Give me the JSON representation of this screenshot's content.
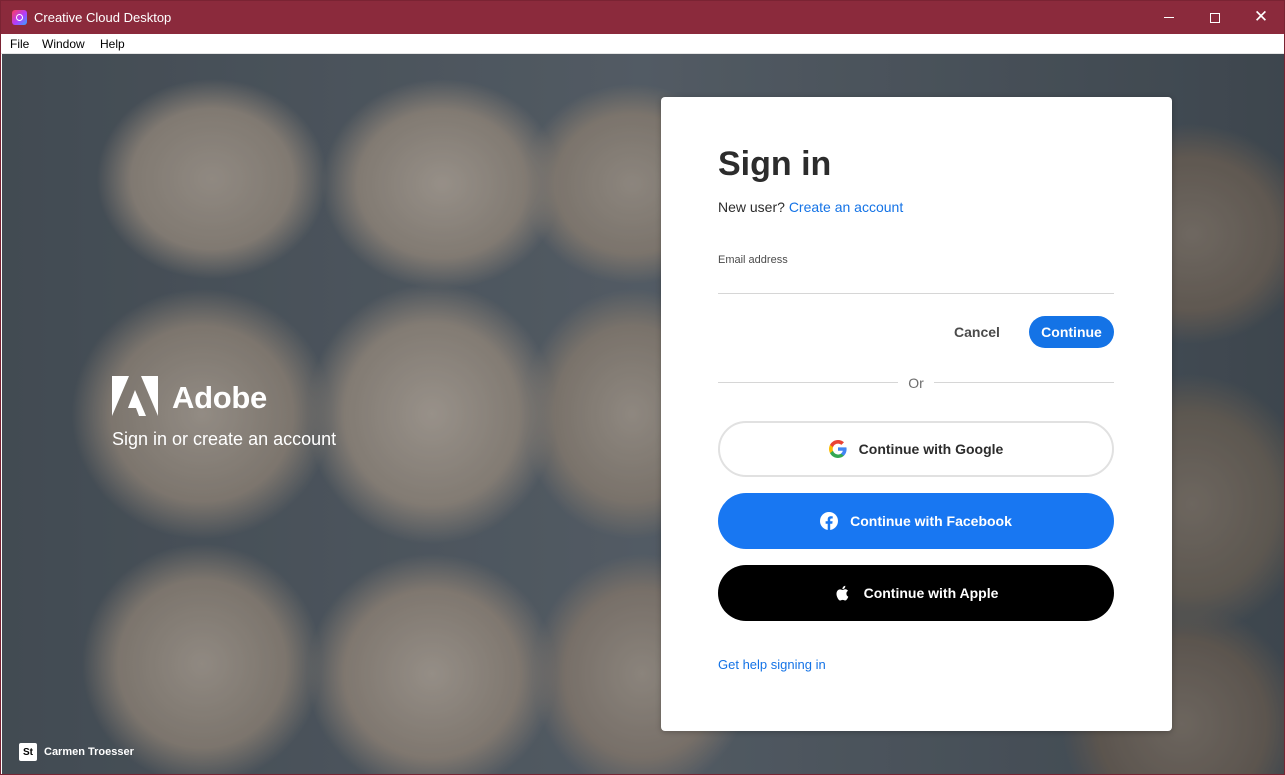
{
  "window": {
    "title": "Creative Cloud Desktop",
    "controls": {
      "minimize_icon": "minimize-icon",
      "maximize_icon": "maximize-icon",
      "close_icon": "close-icon",
      "close_glyph": "✕"
    }
  },
  "menubar": {
    "items": [
      {
        "label": "File"
      },
      {
        "label": "Window"
      },
      {
        "label": "Help"
      }
    ]
  },
  "branding": {
    "logo_icon": "adobe-logo-icon",
    "wordmark": "Adobe",
    "subtitle": "Sign in or create an account"
  },
  "photo_credit": {
    "badge": "St",
    "name": "Carmen Troesser"
  },
  "signin": {
    "title": "Sign in",
    "new_user_prefix": "New user?",
    "create_account_link": "Create an account",
    "email_label": "Email address",
    "email_value": "",
    "cancel_label": "Cancel",
    "continue_label": "Continue",
    "or_text": "Or",
    "social": {
      "google_label": "Continue with Google",
      "facebook_label": "Continue with Facebook",
      "apple_label": "Continue with Apple"
    },
    "help_link": "Get help signing in"
  },
  "colors": {
    "titlebar": "#8b2a3c",
    "accent_blue": "#1473e6",
    "facebook_blue": "#1877f2",
    "apple_black": "#000000"
  }
}
